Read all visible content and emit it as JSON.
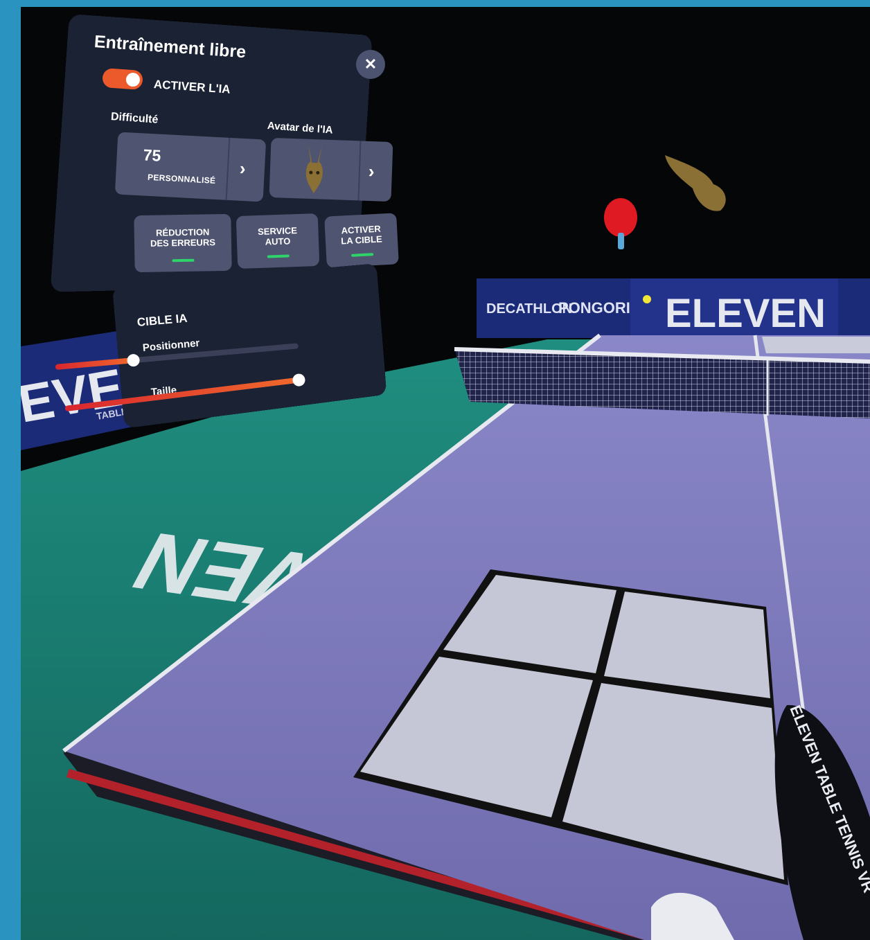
{
  "menu": {
    "title": "Entraînement libre",
    "close_icon": "close-icon",
    "ai_toggle": {
      "label": "ACTIVER L'IA",
      "on": true
    },
    "difficulty": {
      "label": "Difficulté",
      "value": "75",
      "mode": "PERSONNALISÉ"
    },
    "avatar": {
      "label": "Avatar de l'IA",
      "icon": "rabbit-avatar-icon"
    },
    "options": [
      {
        "line1": "RÉDUCTION",
        "line2": "DES ERREURS",
        "enabled": true
      },
      {
        "line1": "SERVICE",
        "line2": "AUTO",
        "enabled": true
      },
      {
        "line1": "ACTIVER",
        "line2": "LA CIBLE",
        "enabled": true
      }
    ]
  },
  "target_panel": {
    "title": "CIBLE IA",
    "position": {
      "label": "Positionner",
      "value": 0.32
    },
    "size": {
      "label": "Taille",
      "value": 1.0
    }
  },
  "scene": {
    "banner_brand": "DECATHLON",
    "banner_sub": "PONGORI",
    "banner_logo": "ELEVEN",
    "left_banner": "EVE",
    "left_banner_sub": "TABLE",
    "floor_text": "ELEVEN",
    "paddle_text": "ELEVEN TABLE TENNIS VR",
    "accent_color": "#ec5a2b",
    "table_color": "#7d79b8",
    "floor_color": "#1f7f74"
  }
}
